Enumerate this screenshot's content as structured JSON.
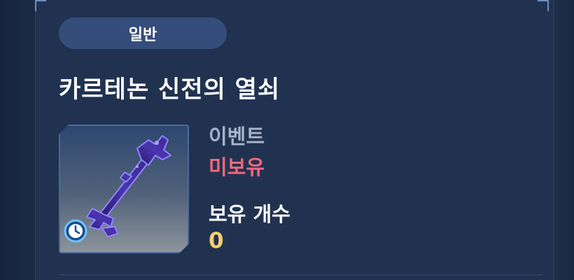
{
  "item": {
    "grade": "일반",
    "name": "카르테논 신전의 열쇠",
    "source": "이벤트",
    "owned_status": "미보유",
    "count_label": "보유 개수",
    "count_value": "0",
    "icon": "dark-key-icon",
    "limited_badge_icon": "clock-icon"
  },
  "colors": {
    "grade_pill": "#344d7a",
    "status_not_owned": "#f0687a",
    "count_value": "#f5cf6e",
    "source_text": "#a8b4c8",
    "panel": "#213251"
  }
}
